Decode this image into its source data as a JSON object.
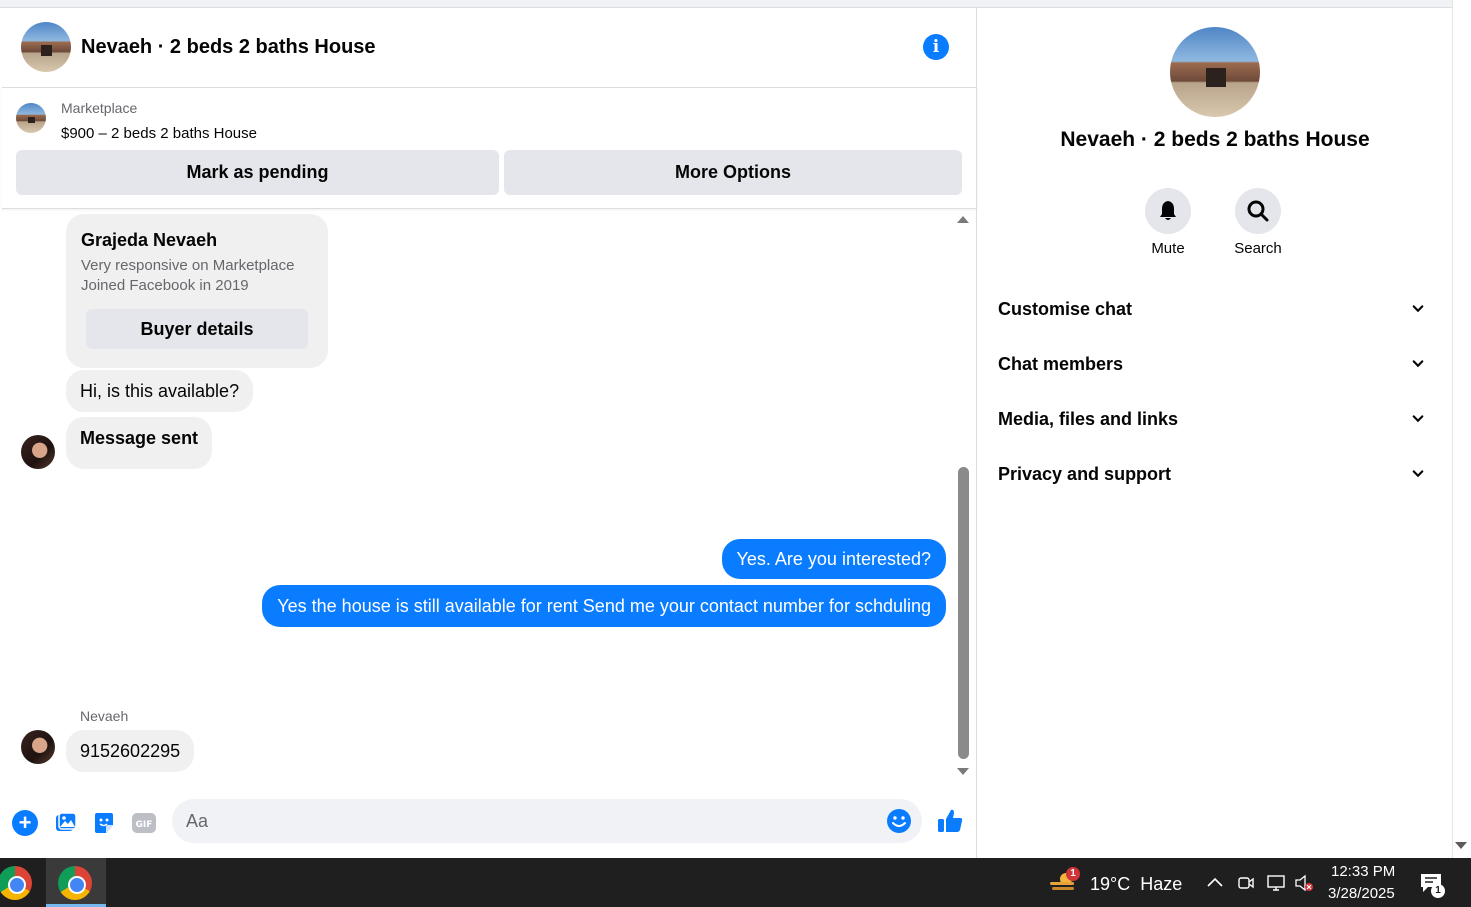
{
  "header": {
    "title": "Nevaeh · 2 beds 2 baths House"
  },
  "marketplace": {
    "label": "Marketplace",
    "listing": "$900 – 2 beds 2 baths House",
    "mark_pending": "Mark as pending",
    "more_options": "More Options"
  },
  "buyer_card": {
    "name": "Grajeda Nevaeh",
    "line1": "Very responsive on Marketplace",
    "line2": "Joined Facebook in 2019",
    "button": "Buyer details"
  },
  "messages": [
    {
      "from": "buyer",
      "text": "Hi, is this available?"
    },
    {
      "from": "buyer",
      "text": "Message sent"
    },
    {
      "from": "me",
      "text": "Yes. Are you interested?"
    },
    {
      "from": "me",
      "text": "Yes the house is still available for rent Send me your contact number for schduling"
    },
    {
      "from": "buyer",
      "sender": "Nevaeh",
      "text": "9152602295"
    }
  ],
  "composer": {
    "placeholder": "Aa"
  },
  "sidebar": {
    "title": "Nevaeh · 2 beds 2 baths House",
    "actions": [
      {
        "label": "Mute",
        "icon": "bell-icon"
      },
      {
        "label": "Search",
        "icon": "search-icon"
      }
    ],
    "sections": [
      "Customise chat",
      "Chat members",
      "Media, files and links",
      "Privacy and support"
    ]
  },
  "taskbar": {
    "weather": "19°C  Haze",
    "weather_badge": "1",
    "time": "12:33 PM",
    "date": "3/28/2025",
    "notification_count": "1"
  },
  "colors": {
    "accent": "#0a7cff",
    "bubble_in": "#f0f0f0",
    "button_gray": "#e4e6eb",
    "taskbar": "#1f1f1f"
  }
}
